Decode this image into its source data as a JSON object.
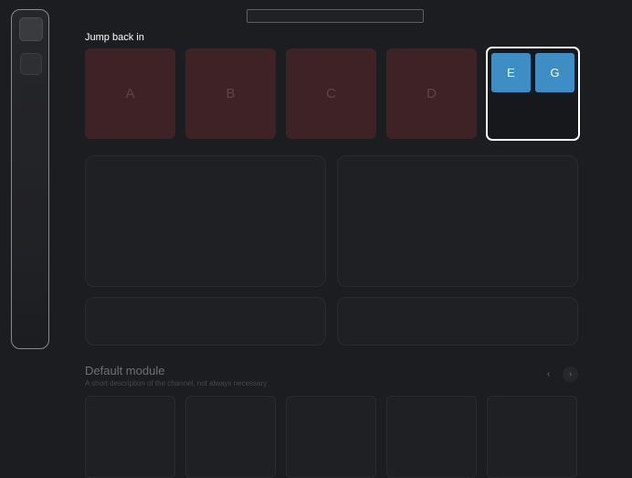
{
  "sidebar": {
    "items": [
      "app-icon",
      "nav-icon",
      "nav-icon",
      "nav-icon",
      "nav-icon"
    ]
  },
  "search": {
    "placeholder": ""
  },
  "jump_back_in": {
    "title": "Jump back in",
    "tiles": [
      "A",
      "B",
      "C",
      "D"
    ],
    "selected_tile": {
      "items": [
        "E",
        "G"
      ]
    }
  },
  "default_module": {
    "title": "Default module",
    "description": "A short description of the channel, not always necessary",
    "prev_icon": "‹",
    "next_icon": "›"
  },
  "colors": {
    "background": "#1c1d20",
    "tile": "#3e2226",
    "accent": "#3e8ec5",
    "selected_border": "#ffffff"
  }
}
